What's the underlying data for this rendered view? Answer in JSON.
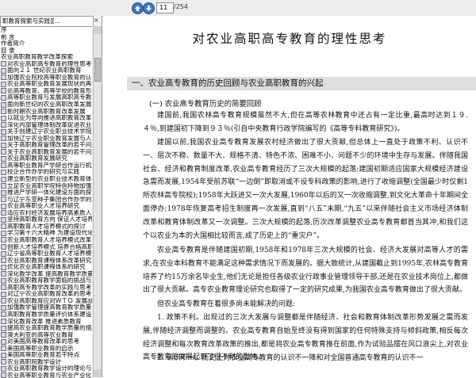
{
  "toolbar": {
    "page_current": "11",
    "page_total": "/254"
  },
  "left_panel": {
    "tab_label": "职教育探索与实践][...",
    "close_label": "×",
    "bookmarks": [
      "序",
      "前 言",
      "作者简介",
      "目 录",
      "农业高职教育教学改革探索",
      "对农业高职高专教育的理性思考",
      "面向２１ 世纪农业高职教育",
      "加强农业院校高等职业教育的认识与实践",
      "农业高等职业教育发展现状的再认识",
      "论高等教育、高等学校的教育形式",
      "高等职业教育与发展高职高专教育",
      "面向新世纪的农业高职改革发展",
      "新时期农业高职教育改革发展",
      "以就业为导向推进高职教育改革",
      "深化内部管理体制改革促进农业高职",
      "关于创建辽宁农业职业技术学院的思考",
      "加快辽宁农业职业教育发展与人才培养",
      "关于高职教育管理改革的若干问题",
      "关于农业高职教育发展的若干问题",
      "农业高职教育发展研究",
      "高等职业教育产学研合作运行机制的探索",
      "校企合作办学的研究与实践",
      "建立新型的农业职业技术教育体系",
      "立足农业高职学院特色特物加强高职教育建设",
      "推进产学研一体化建设方面的探讨",
      "与辽宁东亚种子集团合作办学的实践",
      "农业高等职业人才培养研究",
      "适应农村经济发展培养高素质人才",
      "坚持高职教育方向 保证人才培养质量",
      "高职教育人才培养模式的探讨",
      "学习第十六大精神 为建设现代化农业培养人才",
      "农业高职教育人才培养模式改革与实践",
      "创新人才培养模式 培养合格高职人才",
      "辽宁省高等职业教育人才培养模式改革",
      "农业高职教育课程体系改革研究",
      "优化农业高职课程体系的研究",
      "深化教学改革 提高教育教学质量",
      "农业高职教育教学面临的挑战与对策",
      "高职高专教学改革的实践与思考",
      "对辽宁农业高职教育改革的思考",
      "农业高职教育应对ＷＴＯ 发展战略",
      "加强教学管理提高教育教学质量",
      "高职教育教学质量评价体系建设",
      "深化教育改革 推进素质教育",
      "提高农业高职教育教学质量的措施",
      "澳大利亚的高等农业教育",
      "对美国高等教育改革的思考",
      "美国高等职业教育的启示",
      "美国高等职业教育若干特点",
      "农业高职院教学设计",
      "农业高职教育教学设计的理论与实践研究",
      "农业高等职业教育与农业产业化"
    ]
  },
  "document": {
    "title": "对农业高职高专教育的理性思考",
    "section_heading": "一、农业高专教育的历史回顾与农业高职教育的兴起",
    "sub_heading": "(一) 农业高专教育历史的简要回顾",
    "paragraphs": [
      "建国前,我国农林高专教育规模虽然不大,但在高等农林教育中还占有一定比重,最高时达到１９.４％,到建国初下降到９３％(引自中央教育行政学院编写的《高等专科教育研究》)。",
      "建国以前,我国农业高专教育发展农村经济做出了很大贡献,但总体上一直处于政策不利、认识不一、层次不稳、数量不大、规格不清、特色不浓、困难不小、问题不少的环境中生存与发展。伴随我国社会、经济和教育制度改革,农业高专教育经历了三次大规模的起落:建国初期适应国家大规模经济建设急需而发展,1954年受前苏联“一边倒”即取消或不设专科政策的影响,进行了收缩调整(全国最少时仅剩1所农林高专院校);1958年大跃进又一次大发展,1960年以后的又一次收缩调整,到文化大革命十年期间全面停办;1978年恢复高考招生制度再一次发展,直到“八五”末期,“九五”以来伴随社会主义市场经济体制改革和教育体制改革又一次调整。三次大规模的起落,历次改革调整农业高专教育都首当其冲,和我们这个以农业为本的大国相比较而言,成了历史上的“重灾户”。",
      "农业高专教育是伴随建国初期,1958年和1978年三次大规模的社会、经济大发展对高等人才的需求,在农业本科教育不能满足这种需求情况下而发展的。据大致统计,从建国截止到1995年,农林高专教育培养了约15万余名毕业生,他们无论是担任各级农业行政事业管理领导干部,还是在农业技术岗位上,都做出了很大贡献。高专农业教育理论研究也取得了一定的研究成果,为我国农业高专教育做出了很大贡献。",
      "但农业高专教育在着很多尚未能解决的问题:",
      "1. 政策不利。出现过的三次大发展与调整都是伴随经济、社会和教育体制改革形势发展之需而发展,伴随经济调整而调整的。农业高专教育自始至终没有得到国家的任何特殊支持与倾斜政策,相反每次经济调整和每次教育改革政策的推出,都是将农业高专教育推在前面,作为试验品摆在风口浪尖上,对农业高专教育的发展起到了很不利的影响。",
      "2. 认识不一。历史上对农业高专教育的认识不一降和对全国普通高专教育的认识不一"
    ]
  }
}
